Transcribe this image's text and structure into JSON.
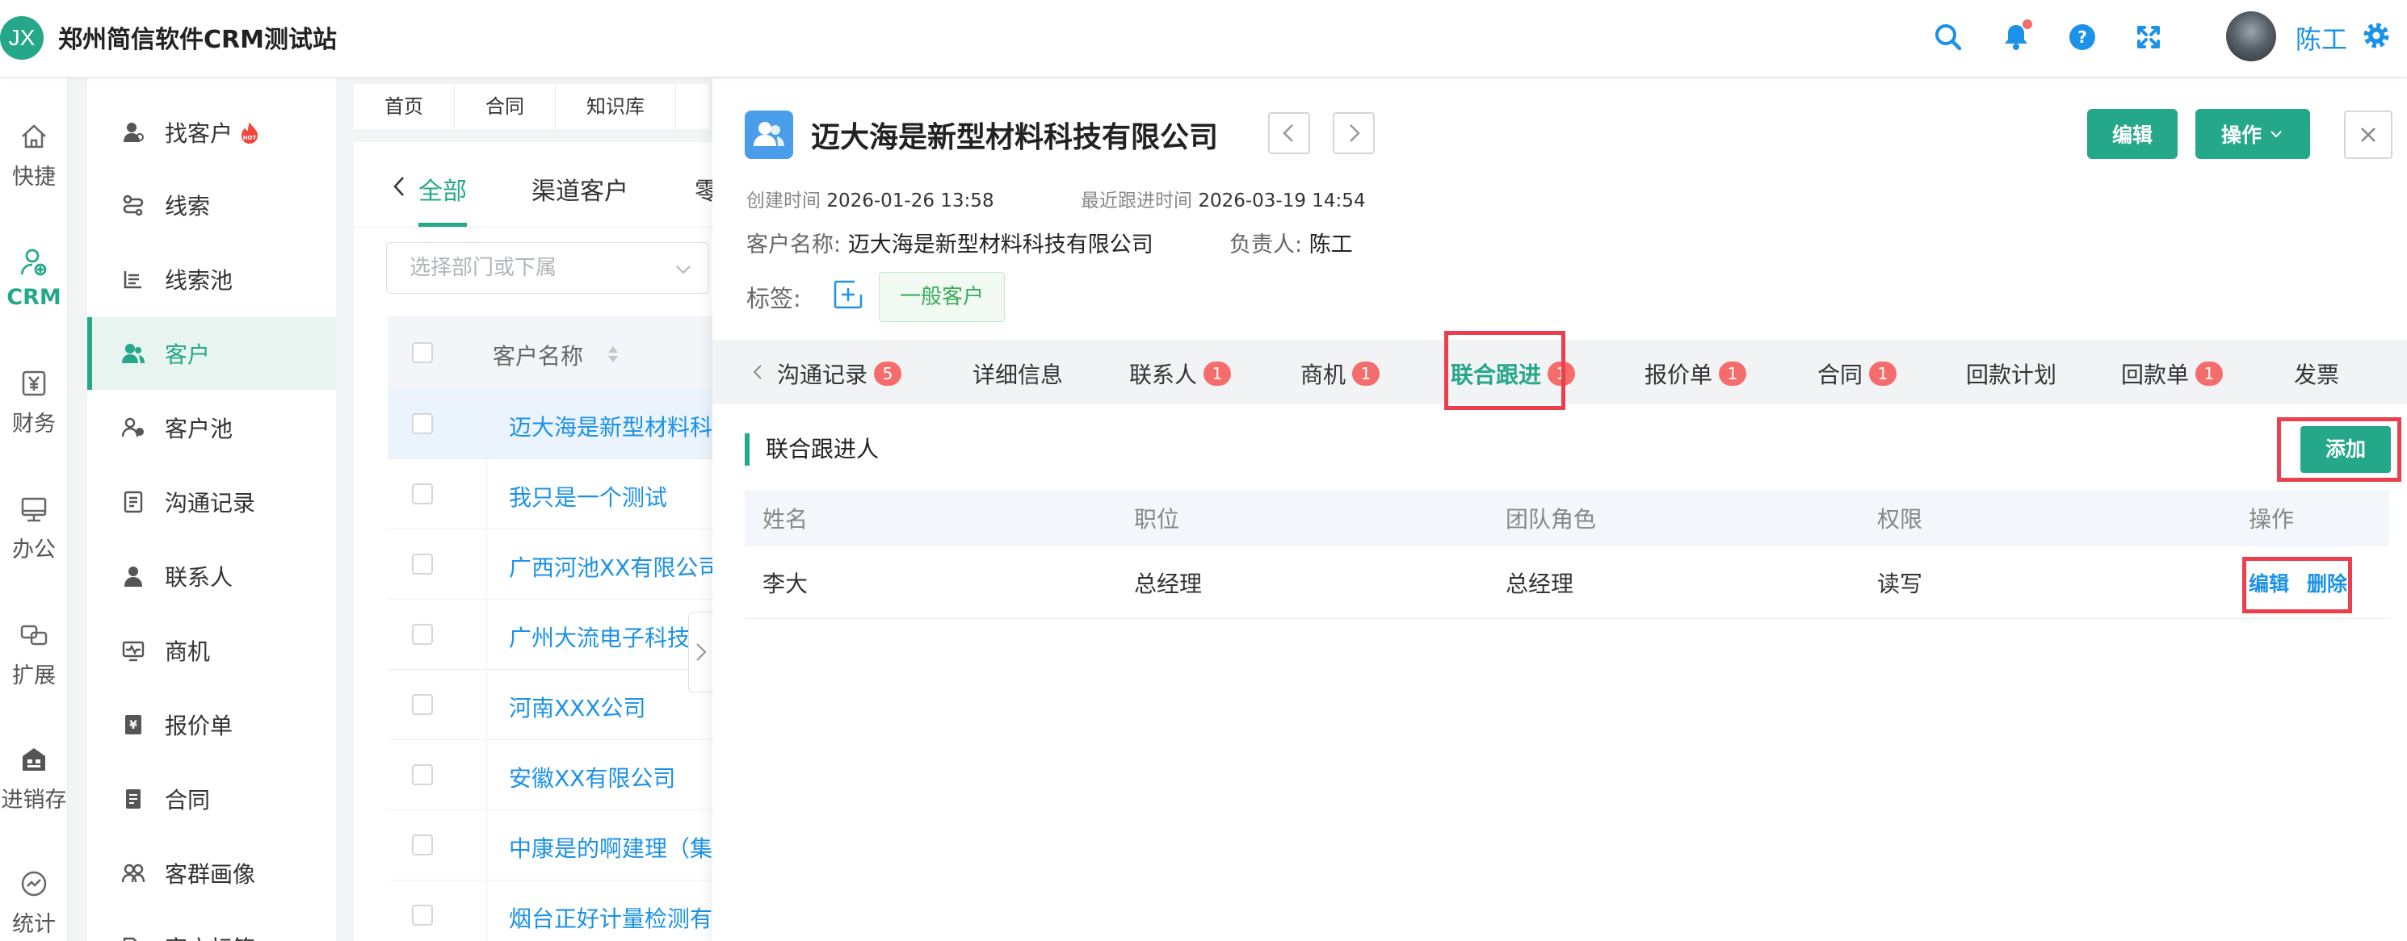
{
  "app": {
    "logo_text": "JX",
    "title": "郑州简信软件CRM测试站",
    "user_name": "陈工"
  },
  "header_icons": [
    "search-icon",
    "bell-icon",
    "help-icon",
    "fullscreen-icon",
    "gear-icon"
  ],
  "rail": {
    "items": [
      {
        "label": "快捷",
        "icon": "home-icon"
      },
      {
        "label": "CRM",
        "icon": "crm-icon",
        "active": true
      },
      {
        "label": "财务",
        "icon": "yen-icon"
      },
      {
        "label": "办公",
        "icon": "monitor-icon"
      },
      {
        "label": "扩展",
        "icon": "extend-icon"
      },
      {
        "label": "进销存",
        "icon": "store-icon"
      },
      {
        "label": "统计",
        "icon": "stats-icon"
      }
    ]
  },
  "menu": {
    "items": [
      {
        "label": "找客户",
        "icon": "find-customer-icon",
        "hot": true
      },
      {
        "label": "线索",
        "icon": "lead-icon"
      },
      {
        "label": "线索池",
        "icon": "lead-pool-icon"
      },
      {
        "label": "客户",
        "icon": "customer-icon",
        "active": true
      },
      {
        "label": "客户池",
        "icon": "customer-pool-icon"
      },
      {
        "label": "沟通记录",
        "icon": "communication-icon"
      },
      {
        "label": "联系人",
        "icon": "contact-icon"
      },
      {
        "label": "商机",
        "icon": "opportunity-icon"
      },
      {
        "label": "报价单",
        "icon": "quote-icon"
      },
      {
        "label": "合同",
        "icon": "contract-icon"
      },
      {
        "label": "客群画像",
        "icon": "portrait-icon"
      },
      {
        "label": "客户标签",
        "icon": "tag-icon"
      }
    ]
  },
  "breadcrumbs": [
    "首页",
    "合同",
    "知识库"
  ],
  "list": {
    "back_tab": "全部",
    "tab2": "渠道客户",
    "tab3": "零",
    "dept_placeholder": "选择部门或下属",
    "column_name": "客户名称",
    "rows": [
      "迈大海是新型材料科技有限公司",
      "我只是一个测试",
      "广西河池XX有限公司",
      "广州大流电子科技有限公司",
      "河南XXX公司",
      "安徽XX有限公司",
      "中康是的啊建理（集团）",
      "烟台正好计量检测有限公司"
    ]
  },
  "detail": {
    "title": "迈大海是新型材料科技有限公司",
    "edit_label": "编辑",
    "action_label": "操作",
    "created_label": "创建时间",
    "created_value": "2026-01-26 13:58",
    "followup_label": "最近跟进时间",
    "followup_value": "2026-03-19 14:54",
    "name_label": "客户名称:",
    "name_value": "迈大海是新型材料科技有限公司",
    "owner_label": "负责人:",
    "owner_value": "陈工",
    "tag_label": "标签:",
    "tag_value": "一般客户",
    "tabs": [
      {
        "label": "沟通记录",
        "badge": "5"
      },
      {
        "label": "详细信息",
        "badge": ""
      },
      {
        "label": "联系人",
        "badge": "1"
      },
      {
        "label": "商机",
        "badge": "1"
      },
      {
        "label": "联合跟进",
        "badge": "1",
        "active": true
      },
      {
        "label": "报价单",
        "badge": "1"
      },
      {
        "label": "合同",
        "badge": "1"
      },
      {
        "label": "回款计划",
        "badge": ""
      },
      {
        "label": "回款单",
        "badge": "1"
      },
      {
        "label": "发票",
        "badge": ""
      }
    ],
    "section_title": "联合跟进人",
    "add_label": "添加",
    "table": {
      "headers": [
        "姓名",
        "职位",
        "团队角色",
        "权限",
        "操作"
      ],
      "rows": [
        {
          "name": "李大",
          "position": "总经理",
          "role": "总经理",
          "permission": "读写",
          "edit": "编辑",
          "delete": "删除"
        }
      ]
    }
  },
  "colors": {
    "accent": "#25a889",
    "link": "#1b92e8",
    "badge": "#f56c6c",
    "highlight_box": "#ec3f4e"
  }
}
